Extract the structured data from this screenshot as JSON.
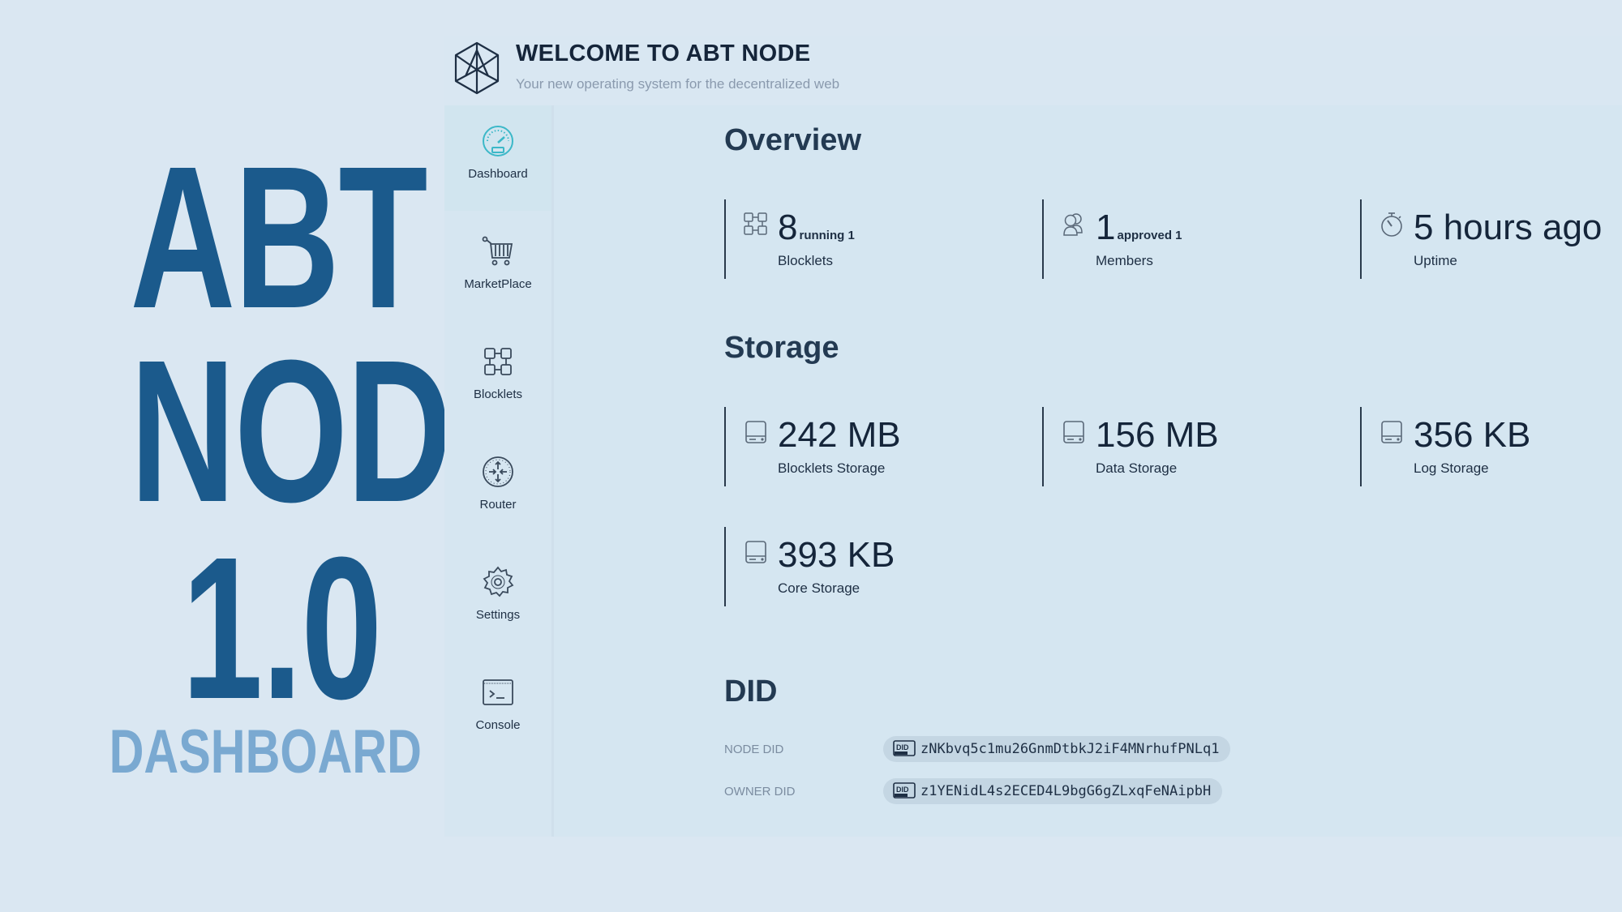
{
  "promo": {
    "line1": "ABT",
    "line2": "NODE",
    "line3": "1.0",
    "line4": "DASHBOARD"
  },
  "header": {
    "title": "WELCOME TO ABT NODE",
    "subtitle": "Your new operating system for the decentralized web",
    "logo_icon": "abt-cube-logo-icon"
  },
  "sidebar": {
    "items": [
      {
        "label": "Dashboard",
        "icon": "speedometer-icon",
        "active": true
      },
      {
        "label": "MarketPlace",
        "icon": "cart-icon",
        "active": false
      },
      {
        "label": "Blocklets",
        "icon": "blocks-icon",
        "active": false
      },
      {
        "label": "Router",
        "icon": "router-compass-icon",
        "active": false
      },
      {
        "label": "Settings",
        "icon": "gear-icon",
        "active": false
      },
      {
        "label": "Console",
        "icon": "terminal-icon",
        "active": false
      }
    ]
  },
  "overview": {
    "title": "Overview",
    "stats": [
      {
        "value": "8",
        "sub": "running 1",
        "caption": "Blocklets",
        "icon": "blocks-icon"
      },
      {
        "value": "1",
        "sub": "approved 1",
        "caption": "Members",
        "icon": "users-icon"
      },
      {
        "value": "5 hours ago",
        "sub": "",
        "caption": "Uptime",
        "icon": "stopwatch-icon"
      }
    ]
  },
  "storage": {
    "title": "Storage",
    "items": [
      {
        "value": "242 MB",
        "caption": "Blocklets Storage",
        "icon": "drive-icon"
      },
      {
        "value": "156 MB",
        "caption": "Data Storage",
        "icon": "drive-icon"
      },
      {
        "value": "356 KB",
        "caption": "Log Storage",
        "icon": "drive-icon"
      },
      {
        "value": "393 KB",
        "caption": "Core Storage",
        "icon": "drive-icon"
      }
    ]
  },
  "did": {
    "title": "DID",
    "rows": [
      {
        "label": "NODE DID",
        "value": "zNKbvq5c1mu26GnmDtbkJ2iF4MNrhufPNLq1"
      },
      {
        "label": "OWNER DID",
        "value": "z1YENidL4s2ECED4L9bgG6gZLxqFeNAipbH"
      }
    ]
  },
  "colors": {
    "background": "#dae7f2",
    "promo_title": "#1b5a8c",
    "promo_subtitle": "#7aa9d1",
    "dashboard_icon_accent": "#3cb8c8",
    "text_dark": "#15253a"
  }
}
